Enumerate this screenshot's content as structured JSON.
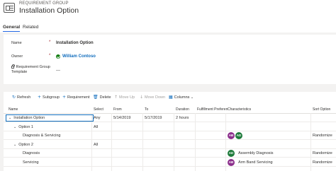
{
  "header": {
    "entity_type": "REQUIREMENT GROUP",
    "title": "Installation Option"
  },
  "tabs": [
    {
      "label": "General",
      "active": true
    },
    {
      "label": "Related",
      "active": false
    }
  ],
  "form": {
    "name_label": "Name",
    "name_value": "Installation Option",
    "owner_label": "Owner",
    "owner_value": "William Contoso",
    "template_label_1": "Requirement Group",
    "template_label_2": "Template",
    "template_value": "---",
    "required_marker": "*"
  },
  "toolbar": {
    "refresh": "Refresh",
    "subgroup": "Subgroup",
    "requirement": "Requirement",
    "delete": "Delete",
    "move_up": "Move Up",
    "move_down": "Move Down",
    "columns": "Columns",
    "columns_caret": "⌄"
  },
  "grid": {
    "columns": [
      "Name",
      "Select",
      "From",
      "To",
      "Duration",
      "Fulfillment Preferen",
      "Characteristics",
      "Sort Option"
    ],
    "rows": [
      {
        "name": "Installation Option",
        "level": 0,
        "expandable": true,
        "select": "Any",
        "from": "5/14/2019",
        "to": "5/17/2019",
        "duration": "2 hours",
        "characteristics": [],
        "sort": ""
      },
      {
        "name": "Option 1",
        "level": 1,
        "expandable": true,
        "select": "All",
        "from": "",
        "to": "",
        "duration": "",
        "characteristics": [],
        "sort": ""
      },
      {
        "name": "Diagnosis & Servicing",
        "level": 2,
        "expandable": false,
        "select": "",
        "from": "",
        "to": "",
        "duration": "",
        "characteristics": [
          {
            "initials": "AB",
            "color": "#8c2f8c"
          },
          {
            "initials": "AD",
            "color": "#1d7a3a"
          }
        ],
        "characteristic_text": "",
        "sort": "Randomize"
      },
      {
        "name": "Option 2",
        "level": 1,
        "expandable": true,
        "select": "All",
        "from": "",
        "to": "",
        "duration": "",
        "characteristics": [],
        "sort": ""
      },
      {
        "name": "Diagnosis",
        "level": 2,
        "expandable": false,
        "select": "",
        "from": "",
        "to": "",
        "duration": "",
        "characteristics": [
          {
            "initials": "AD",
            "color": "#1d7a3a"
          }
        ],
        "characteristic_text": "Assembly Diagnosis",
        "sort": "Randomize"
      },
      {
        "name": "Servicing",
        "level": 2,
        "expandable": false,
        "select": "",
        "from": "",
        "to": "",
        "duration": "",
        "characteristics": [
          {
            "initials": "AB",
            "color": "#8c2f8c"
          }
        ],
        "characteristic_text": "Arm Band Servicing",
        "sort": "Randomize"
      }
    ]
  },
  "icons": {
    "record": "record-icon",
    "refresh": "refresh-icon",
    "add": "plus-icon",
    "delete": "trash-icon",
    "up": "arrow-up-icon",
    "down": "arrow-down-icon",
    "columns": "columns-icon",
    "expand": "chevron-down-icon"
  },
  "colors": {
    "accent": "#0f6cbd",
    "required": "#a4262c",
    "avatar_ab": "#8c2f8c",
    "avatar_ad": "#1d7a3a"
  }
}
